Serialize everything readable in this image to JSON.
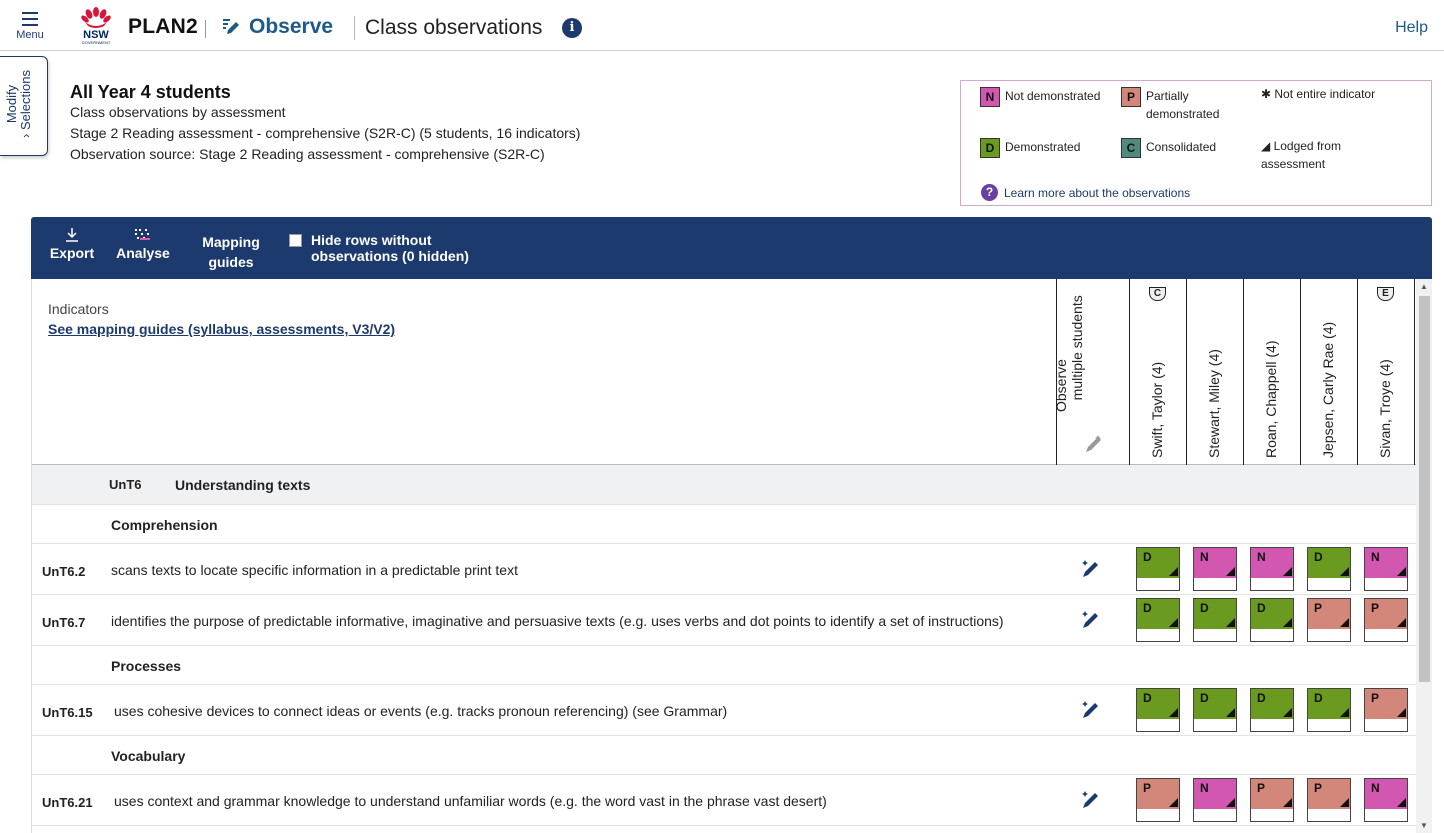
{
  "header": {
    "menu_label": "Menu",
    "logo_text": "NSW",
    "logo_subtext": "GOVERNMENT",
    "brand": "PLAN2",
    "section": "Observe",
    "page_title": "Class observations",
    "info_glyph": "i",
    "help": "Help"
  },
  "side_tab": {
    "line1": "Modify",
    "line2": "Selections",
    "chevron": "›"
  },
  "summary": {
    "title": "All Year 4 students",
    "line1": "Class observations by assessment",
    "line2": "Stage 2 Reading assessment - comprehensive (S2R-C) (5 students, 16 indicators)",
    "line3": "Observation source: Stage 2 Reading assessment - comprehensive (S2R-C)"
  },
  "legend": {
    "items": [
      {
        "code": "N",
        "label": "Not demonstrated",
        "color": "#d157b1"
      },
      {
        "code": "P",
        "label": "Partially demonstrated",
        "color": "#d3877a"
      },
      {
        "code": "D",
        "label": "Demonstrated",
        "color": "#6a9a1f"
      },
      {
        "code": "C",
        "label": "Consolidated",
        "color": "#4e8b7e"
      }
    ],
    "not_entire": "✱ Not entire indicator",
    "lodged": "◢ Lodged from assessment",
    "learn_more": "Learn more about the observations",
    "learn_icon": "?"
  },
  "toolbar": {
    "export": "Export",
    "analyse": "Analyse",
    "mapping_line1": "Mapping",
    "mapping_line2": "guides",
    "hide_rows_line1": "Hide rows without",
    "hide_rows_line2": "observations (0 hidden)"
  },
  "table": {
    "indicators_label": "Indicators",
    "mapping_link": "See mapping guides (syllabus, assessments, V3/V2)",
    "observe_multiple_line1": "Observe",
    "observe_multiple_line2": "multiple students",
    "students": [
      {
        "name": "Swift, Taylor (4)",
        "badge": "C"
      },
      {
        "name": "Stewart, Miley (4)",
        "badge": ""
      },
      {
        "name": "Roan, Chappell (4)",
        "badge": ""
      },
      {
        "name": "Jepsen, Carly Rae (4)",
        "badge": ""
      },
      {
        "name": "Sivan, Troye (4)",
        "badge": "E"
      }
    ],
    "group": {
      "code": "UnT6",
      "label": "Understanding texts"
    },
    "sections": {
      "comprehension": "Comprehension",
      "processes": "Processes",
      "vocabulary": "Vocabulary"
    },
    "rows": [
      {
        "code": "UnT6.2",
        "desc": "scans texts to locate specific information in a predictable print text",
        "marks": [
          "D",
          "N",
          "N",
          "D",
          "N"
        ]
      },
      {
        "code": "UnT6.7",
        "desc": "identifies the purpose of predictable informative, imaginative and persuasive texts (e.g. uses verbs and dot points to identify a set of instructions)",
        "marks": [
          "D",
          "D",
          "D",
          "P",
          "P"
        ]
      },
      {
        "code": "UnT6.15",
        "desc": "uses cohesive devices to connect ideas or events (e.g. tracks pronoun referencing) (see Grammar)",
        "marks": [
          "D",
          "D",
          "D",
          "D",
          "P"
        ]
      },
      {
        "code": "UnT6.21",
        "desc": "uses context and grammar knowledge to understand unfamiliar words (e.g. the word vast in the phrase vast desert)",
        "marks": [
          "P",
          "N",
          "P",
          "P",
          "N"
        ]
      }
    ]
  },
  "colors": {
    "navy": "#1d3a6e",
    "N": "#d157b1",
    "P": "#d3877a",
    "D": "#6a9a1f",
    "C": "#4e8b7e"
  }
}
